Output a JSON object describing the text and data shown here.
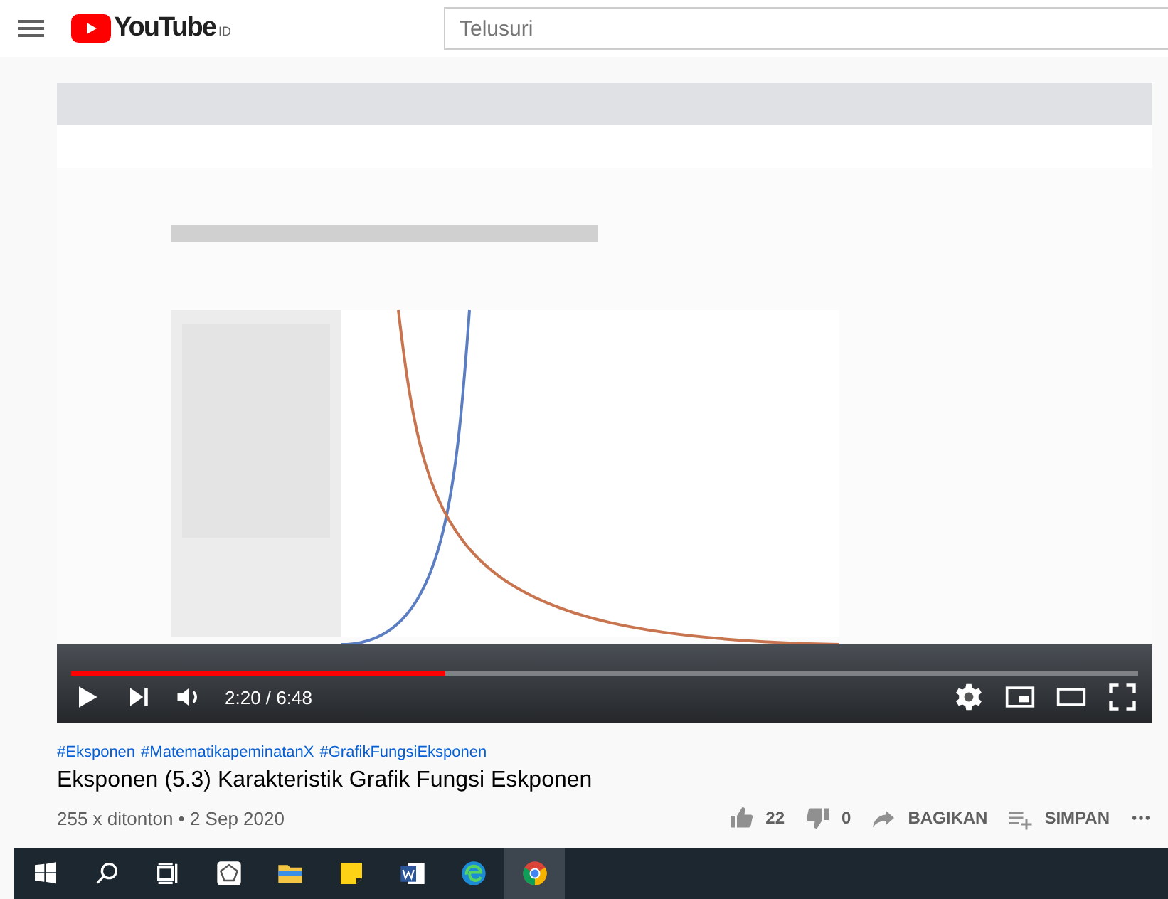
{
  "header": {
    "logo": {
      "text": "YouTube",
      "region": "ID"
    },
    "search": {
      "placeholder": "Telusuri"
    }
  },
  "player": {
    "progress": {
      "level": 0.35
    },
    "time": "2:20 / 6:48"
  },
  "video": {
    "hashtags": [
      "#Eksponen",
      "#MatematikapeminatanX",
      "#GrafikFungsiEksponen"
    ],
    "title": "Eksponen (5.3) Karakteristik Grafik Fungsi Eskponen",
    "meta": "255 x ditonton • 2 Sep 2020",
    "actions": [
      {
        "kind": "like",
        "label": "22"
      },
      {
        "kind": "dislike",
        "label": "0"
      },
      {
        "kind": "share",
        "label": "BAGIKAN"
      },
      {
        "kind": "save",
        "label": "SIMPAN"
      },
      {
        "kind": "more"
      }
    ]
  },
  "taskbar": {
    "apps": [
      {
        "kind": "start",
        "selected": false
      },
      {
        "kind": "search",
        "selected": false
      },
      {
        "kind": "taskview",
        "selected": false
      },
      {
        "kind": "geometry",
        "selected": false
      },
      {
        "kind": "folder",
        "selected": false
      },
      {
        "kind": "note",
        "selected": false
      },
      {
        "kind": "word",
        "selected": false
      },
      {
        "kind": "edge",
        "selected": false
      },
      {
        "kind": "chrome",
        "selected": true
      }
    ]
  }
}
